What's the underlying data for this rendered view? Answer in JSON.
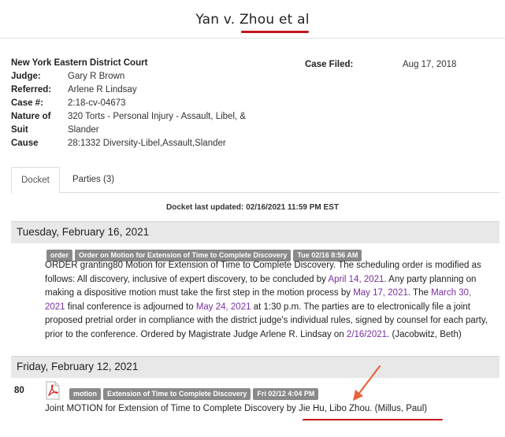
{
  "page": {
    "title": "Yan v. Zhou et al"
  },
  "case": {
    "court": "New York Eastern District Court",
    "judge_label": "Judge:",
    "judge": "Gary R Brown",
    "referred_label": "Referred:",
    "referred": "Arlene R Lindsay",
    "case_label": "Case #:",
    "case_no": "2:18-cv-04673",
    "nature_label_1": "Nature of",
    "nature_label_2": "Suit",
    "nature": "320 Torts - Personal Injury - Assault, Libel, & Slander",
    "cause_label": "Cause",
    "cause": "28:1332 Diversity-Libel,Assault,Slander",
    "filed_label": "Case Filed:",
    "filed": "Aug 17, 2018"
  },
  "tabs": {
    "docket": "Docket",
    "parties": "Parties (3)"
  },
  "docket": {
    "updated": "Docket last updated: 02/16/2021 11:59 PM EST",
    "days": [
      {
        "date": "Tuesday, February 16, 2021",
        "badges": [
          "order",
          "Order on Motion for Extension of Time to Complete Discovery",
          "Tue 02/16 8:56 AM"
        ],
        "text": {
          "p1": "ORDER granting80 Motion for Extension of Time to Complete Discovery. The scheduling order is modified as follows: All discovery, inclusive of expert discovery, to be concluded by ",
          "l1": "April 14, 2021",
          "p2": ". Any party planning on making a dispositive motion must take the first step in the motion process by ",
          "l2": "May 17, 2021",
          "p3": ". The ",
          "l3": "March 30, 2021",
          "p4": " final conference is adjourned to ",
          "l4": "May 24, 2021",
          "p5": " at 1:30 p.m. The parties are to electronically file a joint proposed pretrial order in compliance with the district judge's individual rules, signed by counsel for each party, prior to the conference. Ordered by Magistrate Judge Arlene R. Lindsay on ",
          "l5": "2/16/2021",
          "p6": ". (Jacobwitz, Beth)"
        }
      },
      {
        "date": "Friday, February 12, 2021",
        "number": "80",
        "badges": [
          "motion",
          "Extension of Time to Complete Discovery",
          "Fri 02/12 4:04 PM"
        ],
        "text": "Joint MOTION for Extension of Time to Complete Discovery by Jie Hu, Libo Zhou. (Millus, Paul)"
      }
    ]
  },
  "colors": {
    "accent_red": "#c4161c",
    "link_purple": "#7a2fa0",
    "badge_gray": "#8a8a8a"
  },
  "icons": {
    "pdf": "pdf-icon",
    "arrow": "annotation-arrow-icon"
  }
}
